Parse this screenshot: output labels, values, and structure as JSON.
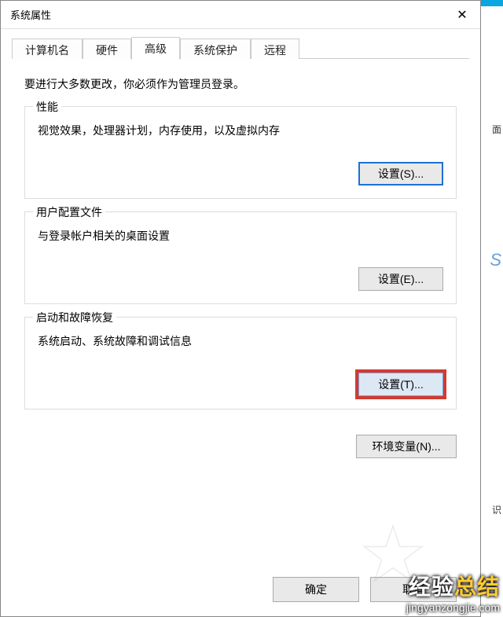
{
  "window": {
    "title": "系统属性",
    "close_glyph": "✕"
  },
  "tabs": {
    "computer_name": "计算机名",
    "hardware": "硬件",
    "advanced": "高级",
    "system_protection": "系统保护",
    "remote": "远程"
  },
  "intro": "要进行大多数更改，你必须作为管理员登录。",
  "groups": {
    "performance": {
      "title": "性能",
      "desc": "视觉效果，处理器计划，内存使用，以及虚拟内存",
      "button": "设置(S)..."
    },
    "user_profiles": {
      "title": "用户配置文件",
      "desc": "与登录帐户相关的桌面设置",
      "button": "设置(E)..."
    },
    "startup_recovery": {
      "title": "启动和故障恢复",
      "desc": "系统启动、系统故障和调试信息",
      "button": "设置(T)..."
    }
  },
  "env_button": "环境变量(N)...",
  "footer": {
    "ok": "确定",
    "cancel": "取消"
  },
  "right_fragments": {
    "a": "面",
    "b": "S",
    "c": "识"
  },
  "watermark": {
    "text_main": "经验",
    "text_accent": "总结",
    "url": "jingyanzongjie.com"
  }
}
